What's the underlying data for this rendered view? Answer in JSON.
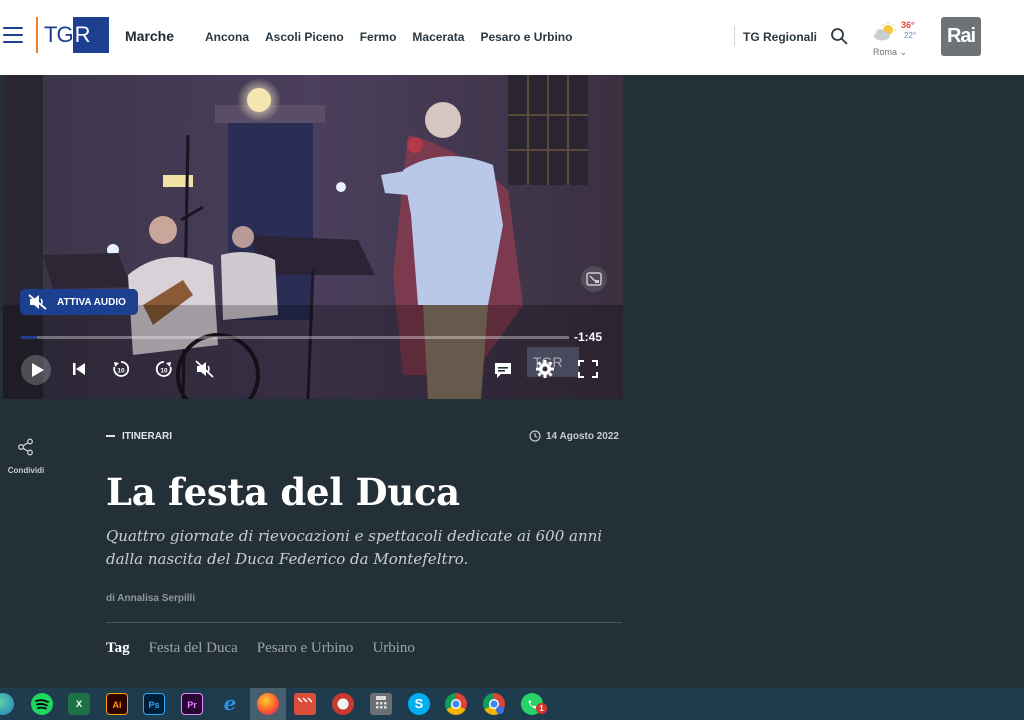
{
  "header": {
    "logo_tg": "TG",
    "logo_r": "R",
    "region": "Marche",
    "nav": [
      "Ancona",
      "Ascoli Piceno",
      "Fermo",
      "Macerata",
      "Pesaro e Urbino"
    ],
    "tg_regionali": "TG Regionali",
    "weather": {
      "temp_max": "36°",
      "temp_min": "22°",
      "city": "Roma"
    },
    "rai_logo": "Rai"
  },
  "video": {
    "audio_button": "ATTIVA AUDIO",
    "time_remaining": "-1:45",
    "progress": 0.03,
    "watermark": "TGR"
  },
  "article": {
    "share_label": "Condividi",
    "category": "ITINERARI",
    "date": "14 Agosto 2022",
    "title": "La festa del Duca",
    "subtitle": "Quattro giornate di rievocazioni e spettacoli dedicate ai 600 anni dalla nascita del Duca Federico da Montefeltro.",
    "author": "di Annalisa Serpilli",
    "tag_label": "Tag",
    "tags": [
      "Festa del Duca",
      "Pesaro e Urbino",
      "Urbino"
    ]
  },
  "taskbar": {
    "apps": [
      "edge-icon",
      "spotify-icon",
      "excel-icon",
      "illustrator-icon",
      "photoshop-icon",
      "premiere-icon",
      "internet-explorer-icon",
      "firefox-icon",
      "clapperboard-icon",
      "rocket-icon",
      "calculator-icon",
      "skype-icon",
      "chrome-icon",
      "chrome-alt-icon",
      "whatsapp-icon"
    ],
    "labels": {
      "excel": "X",
      "illustrator": "Ai",
      "photoshop": "Ps",
      "premiere": "Pr",
      "skype": "S"
    },
    "whatsapp_badge": "1"
  },
  "colors": {
    "brand_blue": "#1c3f90",
    "logo_orange": "#f07e26",
    "page_bg": "#243038"
  }
}
